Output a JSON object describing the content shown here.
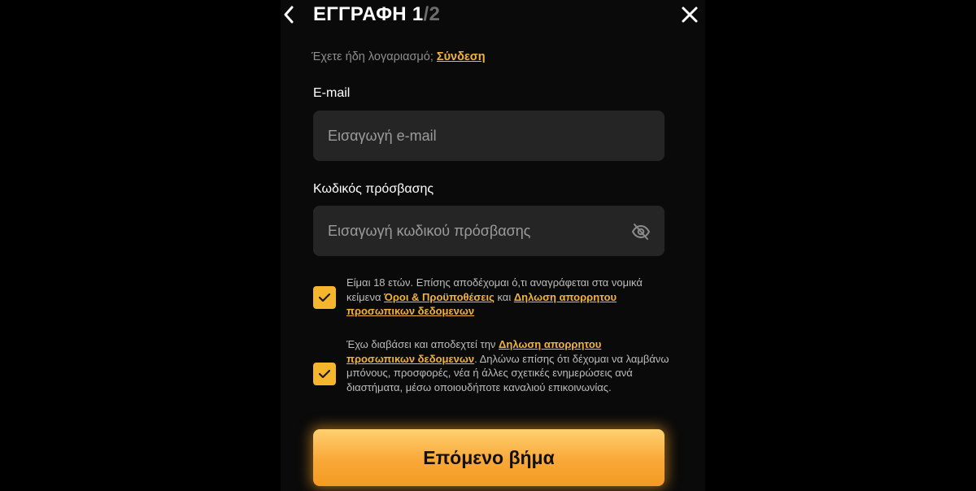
{
  "header": {
    "back_icon": "chevron-left-icon",
    "title_main": "ΕΓΓΡΑΦΗ 1",
    "title_total": "/2",
    "close_icon": "close-icon"
  },
  "login_prompt": {
    "text": "Έχετε ήδη λογαριασμό; ",
    "link": "Σύνδεση"
  },
  "email": {
    "label": "E-mail",
    "placeholder": "Εισαγωγή e-mail",
    "value": ""
  },
  "password": {
    "label": "Κωδικός πρόσβασης",
    "placeholder": "Εισαγωγή κωδικού πρόσβασης",
    "value": "",
    "toggle_icon": "eye-off-icon"
  },
  "consent_terms": {
    "checked": true,
    "text_1": "Είμαι 18 ετών. Επίσης αποδέχομαι ό,τι αναγράφεται στα νομικά κείμενα ",
    "link_terms": "Όροι & Προϋποθέσεις",
    "text_2": " και ",
    "link_privacy": "Δηλωση απορρητου προσωπικων δεδομενων"
  },
  "consent_marketing": {
    "checked": true,
    "text_1": "Έχω διαβάσει και αποδεχτεί την ",
    "link_privacy": "Δηλωση απορρητου προσωπικων δεδομενων",
    "text_2": ". Δηλώνω επίσης ότι δέχομαι να λαμβάνω μπόνους, προσφορές, νέα ή άλλες σχετικές ενημερώσεις ανά διαστήματα, μέσω οποιουδήποτε καναλιού επικοινωνίας."
  },
  "next_button": {
    "label": "Επόμενο βήμα"
  },
  "colors": {
    "background": "#000000",
    "panel": "#0a0a0a",
    "input_bg": "#252525",
    "accent": "#f5b62e",
    "link": "#f2b33d",
    "muted_text": "#8e8e8e"
  }
}
